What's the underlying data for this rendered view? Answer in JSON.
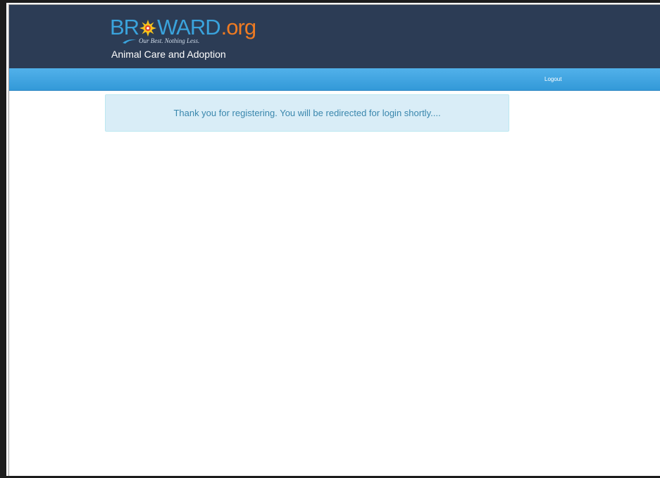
{
  "logo": {
    "wordmark_left": "BR",
    "wordmark_right": "WARD",
    "wordmark_suffix": ".org",
    "tagline": "Our Best. Nothing Less.",
    "sun_icon": "sun-logo-icon",
    "colors": {
      "blue": "#3aa3dc",
      "orange": "#ef7b22",
      "sun_yellow": "#f6c21c",
      "sun_red": "#e2452a"
    }
  },
  "header": {
    "subtitle": "Animal Care and Adoption",
    "background": "#2c3c55"
  },
  "nav": {
    "logout_label": "Logout",
    "background": "#3ba4e2"
  },
  "alert": {
    "message": "Thank you for registering. You will be redirected for login shortly....",
    "background": "#d9edf7",
    "text_color": "#3a87ad"
  }
}
